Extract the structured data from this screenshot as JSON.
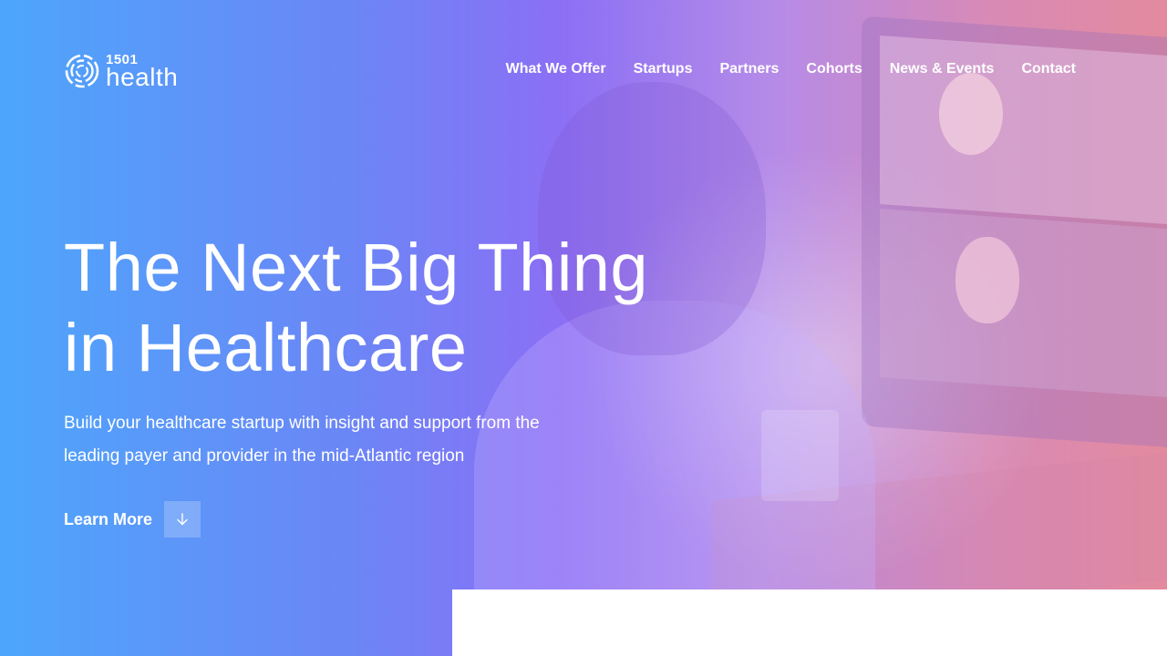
{
  "brand": {
    "logo_number": "1501",
    "logo_word": "health"
  },
  "nav": {
    "items": [
      {
        "label": "What We Offer"
      },
      {
        "label": "Startups"
      },
      {
        "label": "Partners"
      },
      {
        "label": "Cohorts"
      },
      {
        "label": "News & Events"
      },
      {
        "label": "Contact"
      }
    ]
  },
  "hero": {
    "title_line1": "The Next Big Thing",
    "title_line2": "in Healthcare",
    "subtitle": "Build your healthcare startup with insight and support from the leading payer and provider in the mid-Atlantic region",
    "cta_label": "Learn More",
    "cta_icon": "arrow-down-icon"
  },
  "colors": {
    "gradient_left": "#4da6fb",
    "gradient_mid": "#8b6ff5",
    "gradient_right": "#e38a9e",
    "text": "#ffffff"
  }
}
